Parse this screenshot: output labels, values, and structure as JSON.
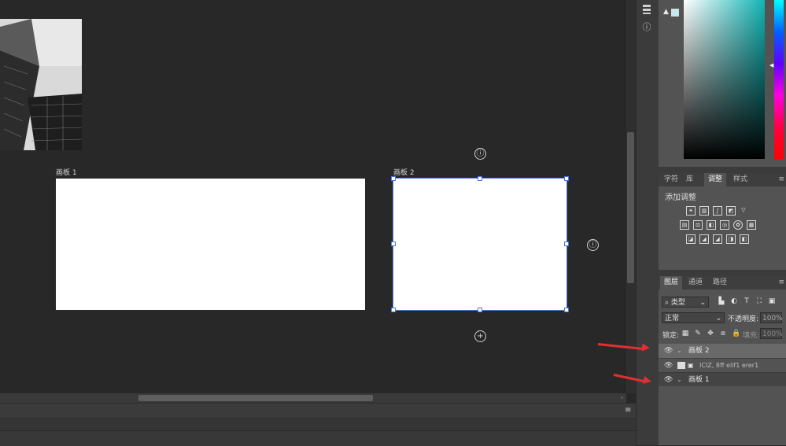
{
  "canvas": {
    "artboard1_label": "画板 1",
    "artboard2_label": "画板 2",
    "add_icon_top": "ⓘ",
    "add_icon_right": "ⓘ",
    "add_icon_bottom": "+"
  },
  "right_rail": {
    "history_icon": "history-icon",
    "info_icon": "info-icon"
  },
  "color_panel": {
    "warning": "▲",
    "swatch_color": "#bfeaf0",
    "hue_color": "#12b5b5"
  },
  "adjust_tabs": [
    "字符",
    "库",
    "调整",
    "样式"
  ],
  "adjust_active_tab": "调整",
  "adjust_title": "添加调整",
  "layers_tabs": [
    "图层",
    "通道",
    "路径"
  ],
  "layers": {
    "filter_value": "类型",
    "blend_mode": "正常",
    "opacity_label": "不透明度:",
    "opacity_value": "100%",
    "lock_label": "锁定:",
    "fill_label": "填充:",
    "fill_value": "100%",
    "rows": [
      {
        "name": "画板 2",
        "group": true
      },
      {
        "name": "ICIZ, 8ff elif1 erer1",
        "group": false
      },
      {
        "name": "画板 1",
        "group": true
      }
    ]
  },
  "colors": {
    "accent": "#4a7bd6",
    "arrow": "#e03030"
  }
}
